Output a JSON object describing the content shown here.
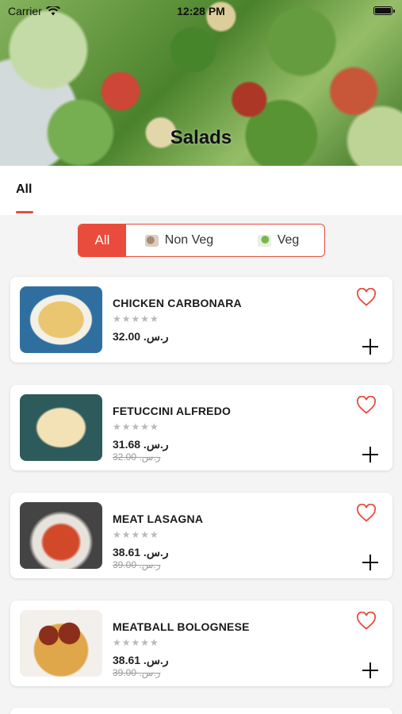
{
  "status_bar": {
    "carrier": "Carrier",
    "time": "12:28 PM"
  },
  "header": {
    "title": "Salads"
  },
  "category_tabs": [
    {
      "label": "All",
      "selected": true
    }
  ],
  "filter": {
    "options": [
      {
        "label": "All",
        "selected": true
      },
      {
        "label": "Non Veg",
        "icon": "non-veg-icon"
      },
      {
        "label": "Veg",
        "icon": "veg-icon"
      }
    ]
  },
  "items": [
    {
      "name": "CHICKEN CARBONARA",
      "stars": "★★★★★",
      "price": "32.00 .ر.س",
      "old_price": ""
    },
    {
      "name": "FETUCCINI ALFREDO",
      "stars": "★★★★★",
      "price": "31.68 .ر.س",
      "old_price": "32.00 .ر.س"
    },
    {
      "name": "MEAT LASAGNA",
      "stars": "★★★★★",
      "price": "38.61 .ر.س",
      "old_price": "39.00 .ر.س"
    },
    {
      "name": "MEATBALL BOLOGNESE",
      "stars": "★★★★★",
      "price": "38.61 .ر.س",
      "old_price": "39.00 .ر.س"
    }
  ],
  "colors": {
    "accent": "#e94c3d",
    "background": "#f4f4f4",
    "card": "#ffffff"
  }
}
